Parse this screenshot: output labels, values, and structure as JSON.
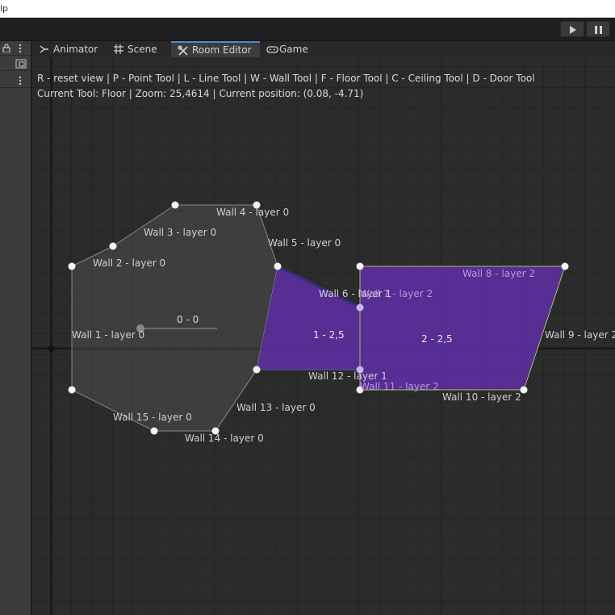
{
  "menubar": {
    "title_fragment": "lp"
  },
  "tabs": [
    {
      "label": "Animator",
      "icon": "animator-icon",
      "active": false
    },
    {
      "label": "Scene",
      "icon": "grid-icon",
      "active": false
    },
    {
      "label": "Room Editor",
      "icon": "tools-icon",
      "active": true
    },
    {
      "label": "Game",
      "icon": "gamepad-icon",
      "active": false
    }
  ],
  "toolbar": {
    "play_icon": "play-icon",
    "pause_icon": "pause-icon"
  },
  "editor": {
    "help_line": "R - reset view | P - Point Tool | L - Line Tool | W - Wall Tool | F - Floor Tool | C - Ceiling Tool | D - Door Tool",
    "status_line": "Current Tool: Floor | Zoom: 25,4614 | Current position: (0.08, -4.71)"
  },
  "colors": {
    "grid_bg": "#2b2b2b",
    "floor_fill": "#5b2fa0",
    "wall_selected": "#a8c060",
    "panel_bg": "#3c3c3c",
    "tab_accent": "#4a8ad6"
  },
  "scene": {
    "origin_label": "0 - 0",
    "floors": [
      {
        "label": "1 - 2,5"
      },
      {
        "label": "2 - 2,5"
      }
    ],
    "walls": [
      {
        "label": "Wall 1 - layer 0"
      },
      {
        "label": "Wall 2 - layer 0"
      },
      {
        "label": "Wall 3 - layer 0"
      },
      {
        "label": "Wall 4 - layer 0"
      },
      {
        "label": "Wall 5 - layer 0"
      },
      {
        "label": "Wall 6 - layer 1"
      },
      {
        "label": "Wall 7 - layer 2"
      },
      {
        "label": "Wall 8 - layer 2"
      },
      {
        "label": "Wall 9 - layer 2"
      },
      {
        "label": "Wall 10 - layer 2"
      },
      {
        "label": "Wall 11 - layer 2"
      },
      {
        "label": "Wall 12 - layer 1"
      },
      {
        "label": "Wall 13 - layer 0"
      },
      {
        "label": "Wall 14 - layer 0"
      },
      {
        "label": "Wall 15 - layer 0"
      }
    ]
  }
}
